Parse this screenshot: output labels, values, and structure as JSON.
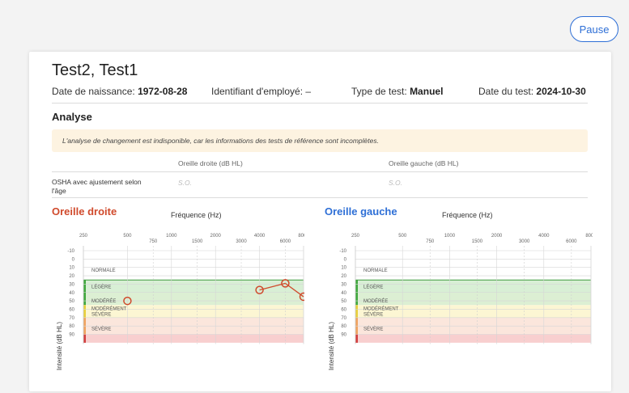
{
  "header": {
    "pause_label": "Pause"
  },
  "patient": {
    "name": "Test2, Test1",
    "dob_label": "Date de naissance:",
    "dob_value": "1972-08-28",
    "employee_label": "Identifiant d'employé:",
    "employee_value": "–",
    "test_type_label": "Type de test:",
    "test_type_value": "Manuel",
    "test_date_label": "Date du test:",
    "test_date_value": "2024-10-30"
  },
  "analysis": {
    "title": "Analyse",
    "notice": "L'analyse de changement est indisponible, car les informations des tests de référence sont incomplètes.",
    "col_right": "Oreille droite (dB HL)",
    "col_left": "Oreille gauche (dB HL)",
    "row_label": "OSHA avec ajustement selon l'âge",
    "row_right": "S.O.",
    "row_left": "S.O."
  },
  "colors": {
    "right_ear": "#d04a2c",
    "left_ear": "#2e6fd6",
    "normal": "#ffffff",
    "mild": "#d8efd5",
    "moderate": "#dcefd3",
    "moderately_severe": "#fcf6d3",
    "severe": "#fbe6dc",
    "profound": "#f8cfcf"
  },
  "chart_data": [
    {
      "type": "scatter",
      "title": "Oreille droite",
      "xlabel": "Fréquence (Hz)",
      "ylabel": "Intensité (dB HL)",
      "x_ticks_top": [
        "250",
        "500",
        "1000",
        "2000",
        "4000",
        "8000"
      ],
      "x_ticks_bottom": [
        "750",
        "1500",
        "3000",
        "6000"
      ],
      "y_ticks": [
        "-10",
        "0",
        "10",
        "20",
        "30",
        "40",
        "50",
        "60",
        "70",
        "80",
        "90"
      ],
      "ylim": [
        -10,
        90
      ],
      "bands": [
        "NORMALE",
        "LÉGÈRE",
        "MODÉRÉE",
        "MODÉRÉMENT SÉVÈRE",
        "SÉVÈRE"
      ],
      "points": [
        {
          "freq": 500,
          "db": 50,
          "connected": false
        },
        {
          "freq": 4000,
          "db": 37,
          "connected": true
        },
        {
          "freq": 6000,
          "db": 29,
          "connected": true
        },
        {
          "freq": 8000,
          "db": 45,
          "connected": true
        }
      ]
    },
    {
      "type": "scatter",
      "title": "Oreille gauche",
      "xlabel": "Fréquence (Hz)",
      "ylabel": "Intensité (dB HL)",
      "x_ticks_top": [
        "250",
        "500",
        "1000",
        "2000",
        "4000",
        "8000"
      ],
      "x_ticks_bottom": [
        "750",
        "1500",
        "3000",
        "6000"
      ],
      "y_ticks": [
        "-10",
        "0",
        "10",
        "20",
        "30",
        "40",
        "50",
        "60",
        "70",
        "80",
        "90"
      ],
      "ylim": [
        -10,
        90
      ],
      "bands": [
        "NORMALE",
        "LÉGÈRE",
        "MODÉRÉE",
        "MODÉRÉMENT SÉVÈRE",
        "SÉVÈRE"
      ],
      "points": []
    }
  ]
}
